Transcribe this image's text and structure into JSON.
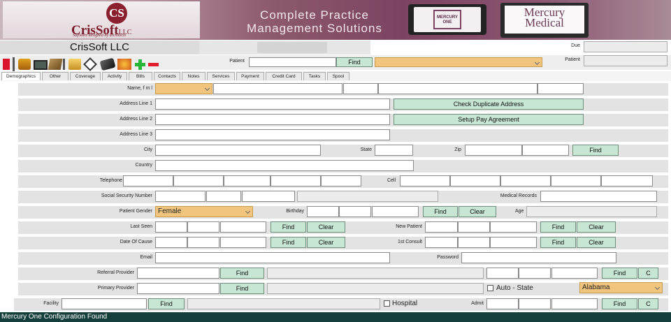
{
  "banner": {
    "logo_mark": "CS",
    "logo_name": "CrisSoft",
    "logo_llc": "LLC",
    "logo_tagline": "Software designed by architects",
    "tagline_line1": "Complete Practice",
    "tagline_line2": "Management Solutions",
    "mercury_one_label": "MERCURY ONE",
    "mercury_medical_line1": "Mercury",
    "mercury_medical_line2": "Medical"
  },
  "header": {
    "company": "CrisSoft LLC",
    "patient_label": "Patient",
    "patient_value": "",
    "find_label": "Find",
    "due_label": "Due",
    "patient_right_label": "Patient"
  },
  "tabs": [
    "Demographics",
    "Other",
    "Coverage",
    "Activity",
    "Bills",
    "Contacts",
    "Notes",
    "Services",
    "Payment",
    "Credit Card",
    "Tasks",
    "Spool"
  ],
  "form": {
    "name_label": "Name, f m l",
    "address1_label": "Address Line 1",
    "address2_label": "Address Line 2",
    "address3_label": "Address Line 3",
    "check_dup_label": "Check Duplicate Address",
    "setup_pay_label": "Setup Pay Agreement",
    "city_label": "City",
    "state_label": "State",
    "zip_label": "Zip",
    "find_label": "Find",
    "country_label": "Country",
    "telephone_label": "Telephone",
    "cell_label": "Cell",
    "ssn_label": "Social Security Number",
    "medical_records_label": "Medical Records",
    "gender_label": "Patient Gender",
    "gender_value": "Female",
    "birthday_label": "Birthday",
    "clear_label": "Clear",
    "age_label": "Age",
    "last_seen_label": "Last Seen",
    "new_patient_label": "New Patient",
    "date_of_cause_label": "Date Of Cause",
    "first_consult_label": "1st Consult",
    "email_label": "Email",
    "password_label": "Password",
    "referral_label": "Referral Provider",
    "c_label": "C",
    "primary_label": "Primary Provider",
    "auto_state_label": "Auto - State",
    "state_value": "Alabama",
    "facility_label": "Facility",
    "hospital_label": "Hospital",
    "admit_label": "Admit"
  },
  "status": {
    "text": "Mercury One Configuration Found"
  }
}
